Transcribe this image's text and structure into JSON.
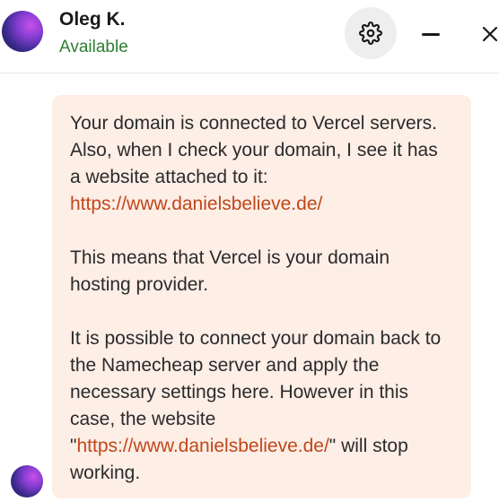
{
  "header": {
    "agent_name": "Oleg K.",
    "status": "Available",
    "settings_icon": "gear-icon",
    "minimize_icon": "minimize-icon",
    "close_icon": "close-icon"
  },
  "message": {
    "p1_text": "Your domain is connected to Vercel servers. Also, when I check your domain, I see it has a website attached to it: ",
    "p1_link": "https://www.danielsbelieve.de/",
    "p2_text": "This means that Vercel is your domain hosting provider.",
    "p3_text": "It is possible to connect your domain back to the Namecheap server and apply the necessary settings here. However in this case, the website \"",
    "p3_link": "https://www.danielsbelieve.de/",
    "p3_tail": "\" will stop working."
  },
  "colors": {
    "status": "#2e7d32",
    "bubble": "#fdeee6",
    "link": "#c0471b"
  }
}
